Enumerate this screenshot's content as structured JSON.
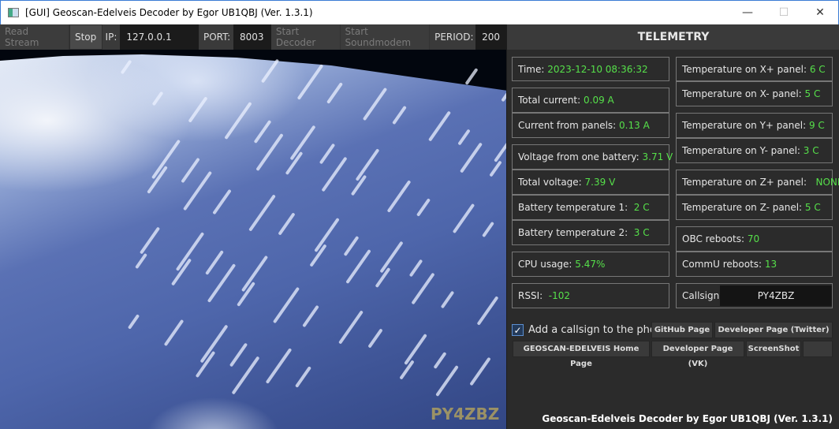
{
  "window": {
    "title": "[GUI] Geoscan-Edelveis Decoder by Egor UB1QBJ (Ver. 1.3.1)",
    "minimize": "—",
    "maximize": "☐",
    "close": "✕"
  },
  "toolbar": {
    "read_stream": "Read Stream",
    "stop": "Stop",
    "ip_label": "IP:",
    "ip_value": "127.0.0.1",
    "port_label": "PORT:",
    "port_value": "8003",
    "start_decoder": "Start Decoder",
    "start_soundmodem": "Start Soundmodem",
    "period_label": "PERIOD:",
    "period_value": "200"
  },
  "photo": {
    "watermark": "PY4ZBZ"
  },
  "telemetry": {
    "title": "TELEMETRY",
    "left": [
      {
        "label": "Time: ",
        "value": "2023-12-10 08:36:32"
      },
      {
        "label": "Total current: ",
        "value": "0.09 A"
      },
      {
        "label": "Current from panels: ",
        "value": "0.13 A"
      },
      {
        "label": "Voltage from one battery: ",
        "value": "3.71 V"
      },
      {
        "label": "Total voltage: ",
        "value": "7.39 V"
      },
      {
        "label": "Battery temperature 1:  ",
        "value": "2 C"
      },
      {
        "label": "Battery temperature 2:  ",
        "value": "3 C"
      },
      {
        "label": "CPU usage: ",
        "value": "5.47%"
      },
      {
        "label": "RSSI:  ",
        "value": "-102"
      }
    ],
    "right": [
      {
        "label": "Temperature on X+ panel: ",
        "value": "6 C"
      },
      {
        "label": "Temperature on X- panel: ",
        "value": "5 C"
      },
      {
        "label": "Temperature on Y+ panel: ",
        "value": "9 C"
      },
      {
        "label": "Temperature on Y- panel: ",
        "value": "3 C"
      },
      {
        "label": "Temperature on Z+ panel:   ",
        "value": "NONE"
      },
      {
        "label": "Temperature on Z- panel: ",
        "value": "5 C"
      },
      {
        "label": "OBC reboots: ",
        "value": "70"
      },
      {
        "label": "CommU reboots: ",
        "value": "13"
      }
    ],
    "callsign_label": "Callsign:",
    "callsign_value": "PY4ZBZ"
  },
  "controls": {
    "checkbox_label": "Add a callsign to the photo?",
    "checked": true,
    "github": "GitHub Page",
    "twitter": "Developer Page (Twitter)",
    "home": "GEOSCAN-EDELVEIS Home Page",
    "vk": "Developer Page (VK)",
    "screenshot": "ScreenShot"
  },
  "footer": "Geoscan-Edelveis Decoder by Egor UB1QBJ (Ver. 1.3.1)"
}
